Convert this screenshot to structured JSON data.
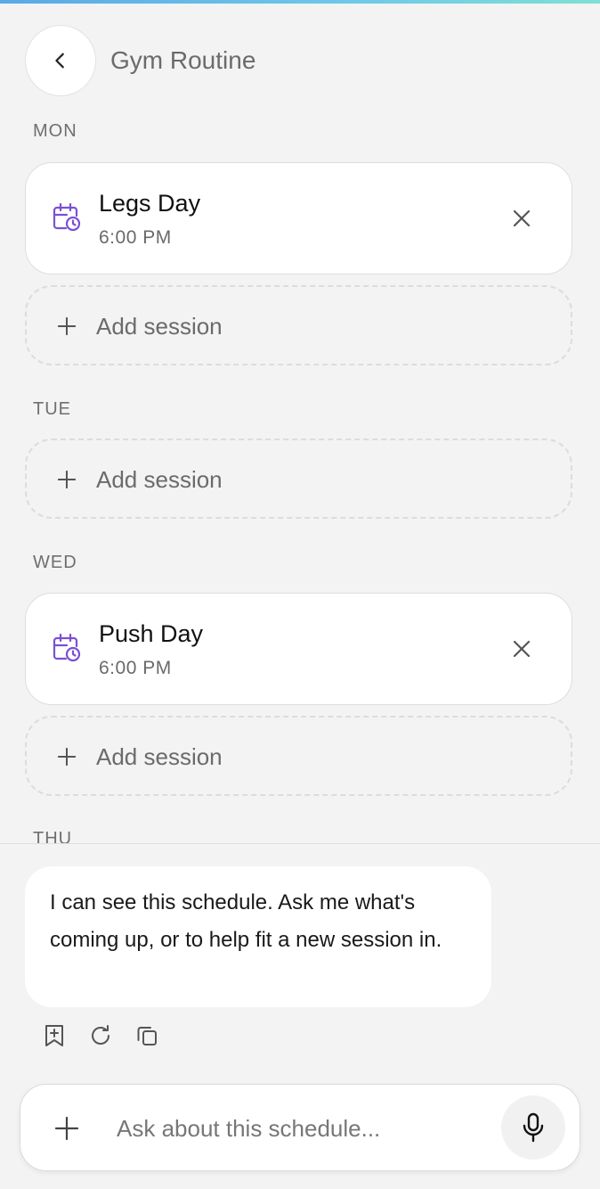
{
  "header": {
    "title": "Gym Routine"
  },
  "schedule": {
    "mon": {
      "label": "MON",
      "sessions": [
        {
          "name": "Legs Day",
          "time": "6:00 PM"
        }
      ],
      "add_label": "Add session"
    },
    "tue": {
      "label": "TUE",
      "add_label": "Add session"
    },
    "wed": {
      "label": "WED",
      "sessions": [
        {
          "name": "Push Day",
          "time": "6:00 PM"
        }
      ],
      "add_label": "Add session"
    },
    "thu": {
      "label": "THU"
    }
  },
  "assistant": {
    "message": "I can see this schedule. Ask me what's coming up, or to help fit a new session in."
  },
  "composer": {
    "placeholder": "Ask about this schedule..."
  },
  "colors": {
    "accent_calendar": "#7b4fd6"
  }
}
